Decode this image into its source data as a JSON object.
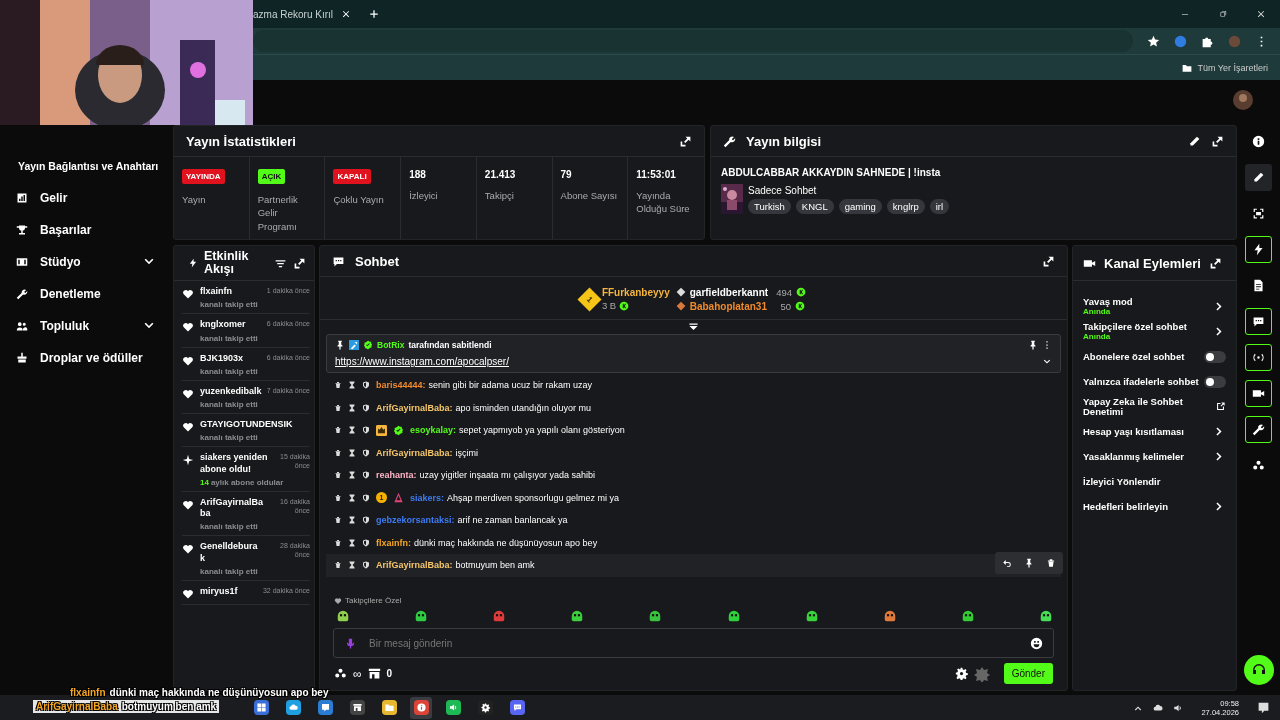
{
  "browser": {
    "tab_title": "azma Rekoru Kırıl",
    "bookmarks_label": "Tüm Yer İşaretleri"
  },
  "sidebar": {
    "header": "Yayın Bağlantısı ve Anahtarı",
    "items": [
      {
        "label": "Gelir",
        "expandable": false
      },
      {
        "label": "Başarılar",
        "expandable": false
      },
      {
        "label": "Stüdyo",
        "expandable": true
      },
      {
        "label": "Denetleme",
        "expandable": false
      },
      {
        "label": "Topluluk",
        "expandable": true
      },
      {
        "label": "Droplar ve ödüller",
        "expandable": false
      }
    ]
  },
  "stats": {
    "title": "Yayın İstatistikleri",
    "items": [
      {
        "kind": "badge",
        "value": "YAYINDA",
        "color": "#e0121e",
        "label": "Yayın"
      },
      {
        "kind": "badge",
        "value": "AÇIK",
        "color": "#53fc18",
        "label": "Partnerlik Gelir Programı"
      },
      {
        "kind": "badge",
        "value": "KAPALI",
        "color": "#e0121e",
        "label": "Çoklu Yayın"
      },
      {
        "kind": "number",
        "value": "188",
        "label": "İzleyici"
      },
      {
        "kind": "number",
        "value": "21.413",
        "label": "Takipçi"
      },
      {
        "kind": "number",
        "value": "79",
        "label": "Abone Sayısı"
      },
      {
        "kind": "number",
        "value": "11:53:01",
        "label": "Yayında Olduğu Süre"
      }
    ]
  },
  "stream_info": {
    "title": "Yayın bilgisi",
    "stream_title": "ABDULCABBAR AKKAYDIN SAHNEDE | !insta",
    "category": "Sadece Sohbet",
    "tags": [
      "Turkish",
      "KNGL",
      "gaming",
      "knglrp",
      "irl"
    ]
  },
  "event_feed": {
    "title": "Etkinlik Akışı",
    "items": [
      {
        "kind": "follow",
        "user": "flxainfn",
        "time": "1 dakika önce",
        "text": "kanalı takip etti"
      },
      {
        "kind": "follow",
        "user": "knglxomer",
        "time": "6 dakika önce",
        "text": "kanalı takip etti"
      },
      {
        "kind": "follow",
        "user": "BJK1903x",
        "time": "6 dakika önce",
        "text": "kanalı takip etti"
      },
      {
        "kind": "follow",
        "user": "yuzenkedibalk",
        "time": "7 dakika önce",
        "text": "kanalı takip etti"
      },
      {
        "kind": "follow",
        "user": "GTAYIGOTUNDENSIK",
        "text": "kanalı takip etti"
      },
      {
        "kind": "resub",
        "user": "siakers yeniden abone oldu!",
        "time": "15 dakika önce",
        "months": "14",
        "text": "aylık abone oldular"
      },
      {
        "kind": "follow",
        "user": "ArifGayirnalBaba",
        "time": "16 dakika önce",
        "text": "kanalı takip etti"
      },
      {
        "kind": "follow",
        "user": "Genelldeburak",
        "time": "28 dakika önce",
        "text": "kanalı takip etti"
      },
      {
        "kind": "follow",
        "user": "miryus1f",
        "time": "32 dakika önce"
      }
    ]
  },
  "chat": {
    "title": "Sohbet",
    "leaderboard": [
      {
        "kind": "top",
        "rank": "1",
        "name": "FFurkanbeyyy",
        "amount": "3 B",
        "color": "#f5b53f"
      },
      {
        "kind": "silver",
        "name": "garfieldberkannt",
        "amount": "494",
        "color": "#ffffff"
      },
      {
        "kind": "bronze",
        "name": "Babahoplatan31",
        "amount": "50",
        "color": "#f08a2c"
      }
    ],
    "pinned": {
      "by": "BotRix",
      "by_text": "tarafından sabitlendi",
      "link": "https://www.instagram.com/apocalpser/"
    },
    "messages": [
      {
        "user": "baris44444:",
        "color": "#f08a2c",
        "text": "senin gibi bir adama ucuz bir rakam uzay",
        "hovered": false
      },
      {
        "user": "ArifGayirnalBaba:",
        "color": "#f5c66b",
        "text": "apo isminden utandığın oluyor mu",
        "hovered": false
      },
      {
        "user": "esoykalay:",
        "color": "#53fc18",
        "text": "sepet yapmıyob ya yapılı olanı gösteriyon",
        "badges": [
          {
            "kind": "crown"
          },
          {
            "kind": "verified"
          }
        ],
        "hovered": false
      },
      {
        "user": "ArifGayirnalBaba:",
        "color": "#f5c66b",
        "text": "işçimi",
        "hovered": false
      },
      {
        "user": "reahanta:",
        "color": "#ffb3c6",
        "text": "uzay yigitler inşaata mı çalışıyor yada sahibi",
        "hovered": false
      },
      {
        "user": "siakers:",
        "color": "#3d7bf5",
        "text": "Ahşap merdiven sponsorlugu gelmez mi ya",
        "badges": [
          {
            "kind": "count",
            "text": "1"
          },
          {
            "kind": "emblem"
          }
        ],
        "hovered": false
      },
      {
        "user": "gebzekorsantaksi:",
        "color": "#3d7bf5",
        "text": "arif ne zaman banlancak ya",
        "hovered": false
      },
      {
        "user": "flxainfn:",
        "color": "#f5a623",
        "text": "dünki maç hakkında ne düşünüyosun apo bey",
        "hovered": false
      },
      {
        "user": "ArifGayirnalBaba:",
        "color": "#f5c66b",
        "text": "botmuyum ben amk",
        "hovered": true
      }
    ],
    "emote_label": "Takipçilere Özel",
    "input": {
      "placeholder": "Bir mesaj gönderin"
    },
    "points": "∞",
    "store_count": "0",
    "send": "Gönder"
  },
  "channel_actions": {
    "title": "Kanal Eylemleri",
    "items": [
      {
        "kind": "arrow",
        "label": "Yavaş mod",
        "sub": "Anında"
      },
      {
        "kind": "arrow",
        "label": "Takipçilere özel sohbet",
        "sub": "Anında"
      },
      {
        "kind": "toggle",
        "label": "Abonelere özel sohbet",
        "on": false
      },
      {
        "kind": "toggle",
        "label": "Yalnızca ifadelerle sohbet",
        "on": false
      },
      {
        "kind": "external",
        "label": "Yapay Zeka ile Sohbet Denetimi"
      },
      {
        "kind": "arrow",
        "label": "Hesap yaşı kısıtlaması"
      },
      {
        "kind": "arrow",
        "label": "Yasaklanmış kelimeler"
      },
      {
        "kind": "plain",
        "label": "İzleyici Yönlendir"
      },
      {
        "kind": "arrow",
        "label": "Hedefleri belirleyin"
      }
    ]
  },
  "right_bar": [
    {
      "active": false,
      "selected": false
    },
    {
      "active": false,
      "selected": true
    },
    {
      "active": false,
      "selected": false
    },
    {
      "active": true,
      "selected": false
    },
    {
      "active": false,
      "selected": false
    },
    {
      "active": true,
      "selected": false
    },
    {
      "active": true,
      "selected": false
    },
    {
      "active": true,
      "selected": false
    },
    {
      "active": true,
      "selected": false
    },
    {
      "active": false,
      "selected": false
    }
  ],
  "caption": [
    {
      "user": "flxainfn",
      "text": "dünki maç hakkında ne düşünüyosun apo bey"
    },
    {
      "user": "ArifGayirnalBaba",
      "text": "botmuyum ben amk"
    }
  ],
  "taskbar": {
    "apps": [
      {
        "kind": "taskview",
        "active": false
      },
      {
        "kind": "edge",
        "active": false
      },
      {
        "kind": "mail",
        "active": false
      },
      {
        "kind": "store",
        "active": false
      },
      {
        "kind": "folder",
        "active": false
      },
      {
        "kind": "chrome",
        "active": true
      },
      {
        "kind": "music",
        "active": false
      },
      {
        "kind": "app",
        "active": false
      },
      {
        "kind": "discord",
        "active": false
      }
    ],
    "time": "09:58",
    "date": "27.04.2026"
  }
}
